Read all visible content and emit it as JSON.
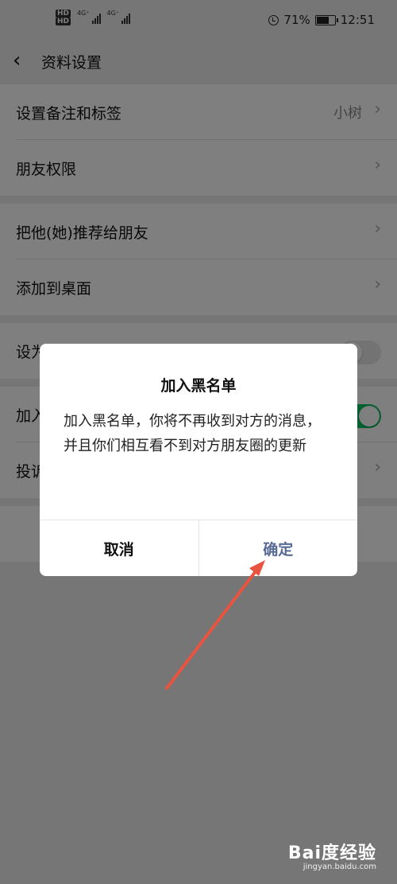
{
  "status_bar": {
    "network_1": "4G⁺",
    "network_2": "4G⁺",
    "hd_badge": "HD",
    "battery_percent": "71%",
    "battery_level": 0.71,
    "time": "12:51"
  },
  "nav": {
    "title": "资料设置"
  },
  "settings": {
    "remark": {
      "label": "设置备注和标签",
      "value": "小树"
    },
    "permissions": {
      "label": "朋友权限"
    },
    "recommend": {
      "label": "把他(她)推荐给朋友"
    },
    "add_to_desktop": {
      "label": "添加到桌面"
    },
    "star_friend": {
      "label": "设为星标朋友",
      "enabled": false
    },
    "blacklist": {
      "label": "加入黑名单",
      "enabled": true
    },
    "complaint": {
      "label": "投诉"
    }
  },
  "dialog": {
    "title": "加入黑名单",
    "message": "加入黑名单，你将不再收到对方的消息，并且你们相互看不到对方朋友圈的更新",
    "cancel_label": "取消",
    "confirm_label": "确定"
  },
  "annotation": {
    "arrow_color": "#e8543f"
  },
  "watermark": {
    "main": "Bai度经验",
    "sub": "jingyan.baidu.com"
  },
  "colors": {
    "accent": "#07c160",
    "dialog_link": "#576b95"
  }
}
